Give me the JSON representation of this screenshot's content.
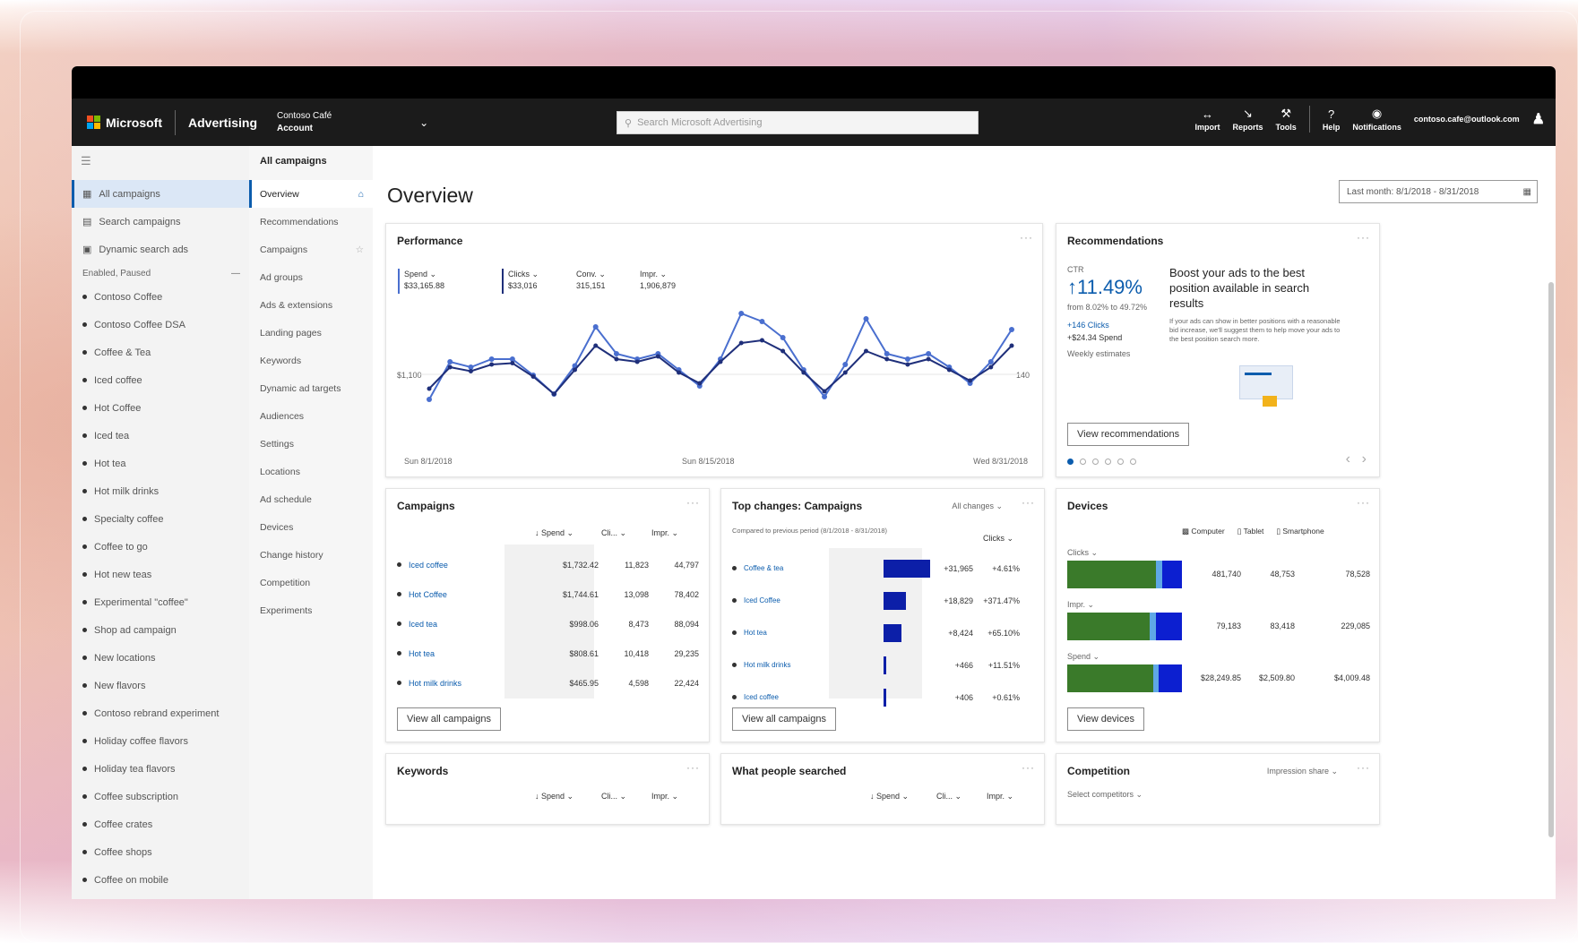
{
  "header": {
    "brand": "Microsoft",
    "product": "Advertising",
    "account_name": "Contoso Café",
    "account_label": "Account",
    "search_placeholder": "Search Microsoft Advertising",
    "buttons": [
      {
        "label": "Import",
        "icon": "import-icon"
      },
      {
        "label": "Reports",
        "icon": "reports-icon"
      },
      {
        "label": "Tools",
        "icon": "tools-icon"
      },
      {
        "label": "Help",
        "icon": "help-icon"
      },
      {
        "label": "Notifications",
        "icon": "bell-icon"
      }
    ],
    "user_email": "contoso.cafe@outlook.com"
  },
  "left_nav": {
    "items": [
      "All campaigns",
      "Search campaigns",
      "Dynamic search ads"
    ],
    "section_label": "Enabled, Paused",
    "campaigns": [
      "Contoso Coffee",
      "Contoso Coffee DSA",
      "Coffee & Tea",
      "Iced coffee",
      "Hot Coffee",
      "Iced tea",
      "Hot tea",
      "Hot milk drinks",
      "Specialty coffee",
      "Coffee to go",
      "Hot new teas",
      "Experimental \"coffee\"",
      "Shop ad campaign",
      "New locations",
      "New flavors",
      "Contoso rebrand experiment",
      "Holiday coffee flavors",
      "Holiday tea flavors",
      "Coffee subscription",
      "Coffee crates",
      "Coffee shops",
      "Coffee on mobile"
    ]
  },
  "sub_nav": {
    "title": "All campaigns",
    "items": [
      "Overview",
      "Recommendations",
      "Campaigns",
      "Ad groups",
      "Ads & extensions",
      "Landing pages",
      "Keywords",
      "Dynamic ad targets",
      "Audiences",
      "Settings",
      "Locations",
      "Ad schedule",
      "Devices",
      "Change history",
      "Competition",
      "Experiments"
    ]
  },
  "page": {
    "title": "Overview",
    "date_range": "Last month: 8/1/2018 - 8/31/2018"
  },
  "performance": {
    "title": "Performance",
    "kpis": [
      {
        "label": "Spend",
        "value": "$33,165.88"
      },
      {
        "label": "Clicks",
        "value": "$33,016"
      },
      {
        "label": "Conv.",
        "value": "315,151"
      },
      {
        "label": "Impr.",
        "value": "1,906,879"
      }
    ],
    "y_left_label": "$1,100",
    "y_right_label": "140",
    "x_labels": [
      "Sun 8/1/2018",
      "Sun 8/15/2018",
      "Wed 8/31/2018"
    ]
  },
  "chart_data": {
    "type": "line",
    "series": [
      {
        "name": "Spend",
        "color": "#4a6fcf",
        "values": [
          28,
          56,
          52,
          58,
          58,
          46,
          32,
          53,
          82,
          62,
          58,
          62,
          50,
          38,
          58,
          92,
          86,
          74,
          50,
          30,
          54,
          88,
          62,
          58,
          62,
          52,
          40,
          56,
          80
        ]
      },
      {
        "name": "Clicks",
        "color": "#1f2f7a",
        "values": [
          36,
          52,
          49,
          54,
          55,
          45,
          32,
          50,
          68,
          58,
          56,
          60,
          48,
          40,
          56,
          70,
          72,
          64,
          48,
          34,
          48,
          64,
          58,
          54,
          58,
          50,
          42,
          52,
          68
        ]
      }
    ]
  },
  "recommendations": {
    "title": "Recommendations",
    "metric_label": "CTR",
    "metric_value": "11.49%",
    "metric_from": "from 8.02% to 49.72%",
    "lines": [
      "+146 Clicks",
      "+$24.34 Spend",
      "Weekly estimates"
    ],
    "heading": "Boost your ads to the best position available in search results",
    "body": "If your ads can show in better positions with a reasonable bid increase, we'll suggest them to help move your ads to the best position search more.",
    "button": "View recommendations"
  },
  "campaigns_card": {
    "title": "Campaigns",
    "columns": [
      "Spend",
      "Cli...",
      "Impr."
    ],
    "rows": [
      {
        "name": "Iced coffee",
        "spend": "$1,732.42",
        "clicks": "11,823",
        "impr": "44,797"
      },
      {
        "name": "Hot Coffee",
        "spend": "$1,744.61",
        "clicks": "13,098",
        "impr": "78,402"
      },
      {
        "name": "Iced tea",
        "spend": "$998.06",
        "clicks": "8,473",
        "impr": "88,094"
      },
      {
        "name": "Hot tea",
        "spend": "$808.61",
        "clicks": "10,418",
        "impr": "29,235"
      },
      {
        "name": "Hot milk drinks",
        "spend": "$465.95",
        "clicks": "4,598",
        "impr": "22,424"
      }
    ],
    "button": "View all campaigns"
  },
  "top_changes": {
    "title": "Top changes: Campaigns",
    "filter": "All changes",
    "compared": "Compared to previous period (8/1/2018 - 8/31/2018)",
    "metric": "Clicks",
    "rows": [
      {
        "name": "Coffee & tea",
        "value": "+31,965",
        "pct": "+4.61%",
        "size": 1.0
      },
      {
        "name": "Iced Coffee",
        "value": "+18,829",
        "pct": "+371.47%",
        "size": 0.48
      },
      {
        "name": "Hot tea",
        "value": "+8,424",
        "pct": "+65.10%",
        "size": 0.38
      },
      {
        "name": "Hot milk drinks",
        "value": "+466",
        "pct": "+11.51%",
        "size": 0.03
      },
      {
        "name": "Iced coffee",
        "value": "+406",
        "pct": "+0.61%",
        "size": 0.02
      }
    ],
    "button": "View all campaigns"
  },
  "devices": {
    "title": "Devices",
    "legend": [
      "Computer",
      "Tablet",
      "Smartphone"
    ],
    "rows": [
      {
        "label": "Clicks",
        "values": [
          "481,740",
          "48,753",
          "78,528"
        ],
        "shares": [
          0.77,
          0.06,
          0.17
        ]
      },
      {
        "label": "Impr.",
        "values": [
          "79,183",
          "83,418",
          "229,085"
        ],
        "shares": [
          0.72,
          0.05,
          0.23
        ]
      },
      {
        "label": "Spend",
        "values": [
          "$28,249.85",
          "$2,509.80",
          "$4,009.48"
        ],
        "shares": [
          0.75,
          0.05,
          0.2
        ]
      }
    ],
    "colors": [
      "#3a7a2a",
      "#5fa8e6",
      "#0c1fd0"
    ],
    "button": "View devices"
  },
  "keywords": {
    "title": "Keywords",
    "columns": [
      "Spend",
      "Cli...",
      "Impr."
    ]
  },
  "searched": {
    "title": "What people searched",
    "columns": [
      "Spend",
      "Cli...",
      "Impr."
    ]
  },
  "competition": {
    "title": "Competition",
    "filter": "Impression share",
    "select": "Select competitors"
  }
}
